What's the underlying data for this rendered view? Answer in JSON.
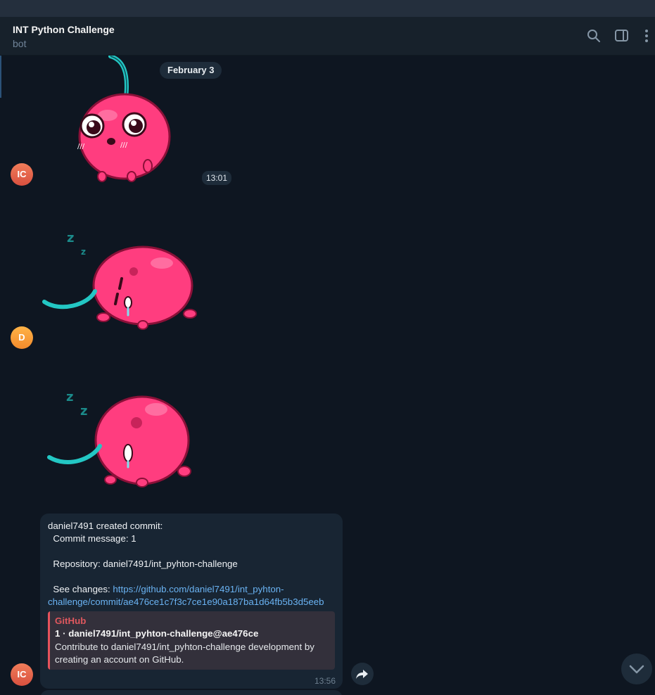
{
  "header": {
    "title": "INT Python Challenge",
    "subtitle": "bot",
    "icons": [
      "search-icon",
      "sidebar-toggle-icon",
      "more-vertical-icon"
    ]
  },
  "date_divider": "February 3",
  "messages": [
    {
      "type": "sticker",
      "sender_initials": "IC",
      "sticker": "cherry-surprised",
      "time": "13:01"
    },
    {
      "type": "sticker",
      "sender_initials": "D",
      "sticker": "cherry-sleeping"
    },
    {
      "type": "sticker",
      "sticker": "cherry-sleeping"
    },
    {
      "type": "text",
      "sender_initials": "IC",
      "text": "daniel7491 created commit:\n  Commit message: 1\n\n  Repository: daniel7491/int_pyhton-challenge\n\n  See changes: ",
      "link": "https://github.com/daniel7491/int_pyhton-challenge/commit/ae476ce1c7f3c7ce1e90a187ba1d64fb5b3d5eeb",
      "link_display": "https://github.com/daniel7491/int_pyhton-\nchallenge/commit/ae476ce1c7f3c7ce1e90a187ba1d64fb5b3d5eeb",
      "preview": {
        "site": "GitHub",
        "title": "1 · daniel7491/int_pyhton-challenge@ae476ce",
        "description": "Contribute to daniel7491/int_pyhton-challenge development by creating an account on GitHub."
      },
      "time": "13:56"
    }
  ],
  "colors": {
    "background": "#0e1621",
    "header": "#17212b",
    "bubble": "#182533",
    "link": "#6ab3f3",
    "preview_accent": "#e5535c"
  }
}
